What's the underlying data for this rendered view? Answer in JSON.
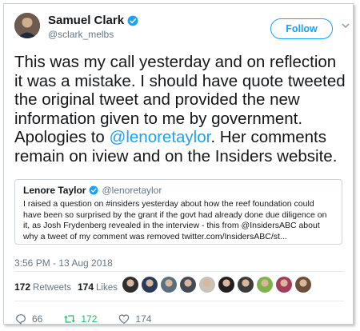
{
  "author": {
    "name": "Samuel Clark",
    "handle": "@sclark_melbs",
    "follow_label": "Follow"
  },
  "tweet": {
    "text_before": "This was my call yesterday and on reflection it was a mistake. I should have quote tweeted the original tweet and provided the new information given to me by government. Apologies to ",
    "mention": "@lenoretaylor",
    "text_after": ". Her comments remain on iview and on the Insiders website.",
    "timestamp": "3:56 PM - 13 Aug 2018"
  },
  "quoted_tweet": {
    "name": "Lenore Taylor",
    "handle": "@lenoretaylor",
    "text": "I raised a question on #insiders yesterday about how the reef foundation could have been so surprised by the grant if the govt had already done due diligence on it, as Josh Frydenberg revealed in the interview - this from @InsidersABC about why a tweet of my comment was removed twitter.com/InsidersABC/st..."
  },
  "stats": {
    "retweets_count": "172",
    "retweets_label": "Retweets",
    "likes_count": "174",
    "likes_label": "Likes"
  },
  "liker_faces": [
    "#2e2e2e",
    "#2a3a5a",
    "#5a7080",
    "#444a55",
    "#c9c2b8",
    "#1f1f1f",
    "#3b3b3b",
    "#7fb24a",
    "#a33d5a",
    "#6b4f3a"
  ],
  "actions": {
    "reply_count": "66",
    "retweet_count": "172",
    "like_count": "174"
  },
  "colors": {
    "accent": "#1da1f2",
    "retweet_green": "#17bf63",
    "muted": "#657786"
  }
}
